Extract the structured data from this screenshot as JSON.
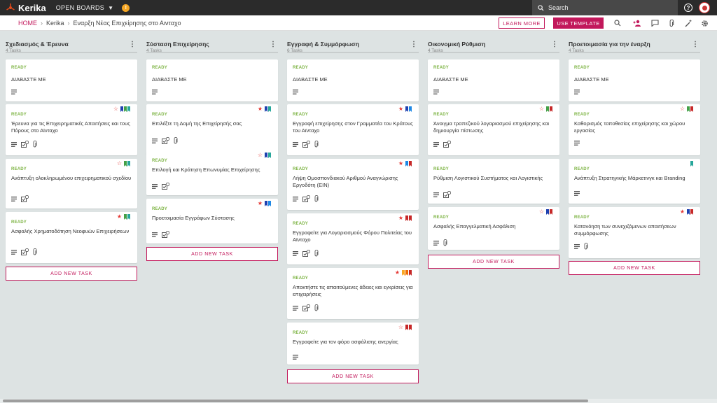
{
  "topbar": {
    "logo_text": "Kerika",
    "open_boards": "OPEN BOARDS",
    "notification_badge": "!",
    "search_label": "Search",
    "help_label": "?"
  },
  "breadcrumb": {
    "home": "HOME",
    "account": "Kerika",
    "board": "Εναρξη Νέας Επιχείρησης στο Αινταχο"
  },
  "toolbar": {
    "learn_more": "LEARN MORE",
    "use_template": "USE TEMPLATE"
  },
  "colors": {
    "accent": "#c2185b",
    "ready": "#7cb342",
    "star": "#e53935"
  },
  "add_task_label": "ADD NEW TASK",
  "columns": [
    {
      "title": "Σχεδιασμός & Έρευνα",
      "count": "4 Tasks",
      "cards": [
        {
          "status": "READY",
          "title": "ΔΙΑΒΑΣΤΕ ΜΕ",
          "star": "none",
          "flags": [],
          "icons": [
            "description"
          ]
        },
        {
          "status": "READY",
          "title": "Έρευνα για τις Επιχειρηματικές Απαιτήσεις και τους Πόρους στο Αϊνταχο",
          "star": "outline",
          "flags": [
            "#1e40af",
            "#43a047",
            "#26a69a"
          ],
          "icons": [
            "description",
            "checklist",
            "attachment"
          ]
        },
        {
          "status": "READY",
          "title": "Ανάπτυξη ολοκληρωμένου επιχειρηματικού σχεδίου",
          "star": "outline",
          "flags": [
            "#43a047",
            "#26a69a"
          ],
          "icons": [
            "description",
            "checklist"
          ]
        },
        {
          "status": "READY",
          "title": "Ασφαλής Χρηματοδότηση Νεοφυών Επιχειρήσεων",
          "star": "filled",
          "flags": [
            "#43a047",
            "#26a69a"
          ],
          "icons": [
            "description",
            "checklist",
            "attachment"
          ]
        }
      ]
    },
    {
      "title": "Σύσταση Επιχείρησης",
      "count": "4 Tasks",
      "cards": [
        {
          "status": "READY",
          "title": "ΔΙΑΒΑΣΤΕ ΜΕ",
          "star": "none",
          "flags": [],
          "icons": [
            "description"
          ]
        },
        {
          "status": "READY",
          "title": "Επιλέξτε τη Δομή της Επιχείρησής σας",
          "star": "filled",
          "flags": [
            "#1e40af",
            "#26a69a"
          ],
          "icons": [
            "description",
            "checklist",
            "attachment"
          ]
        },
        {
          "status": "READY",
          "title": "Επιλογή και Κράτηση Επωνυμίας Επιχείρησης",
          "star": "outline",
          "flags": [
            "#1e40af",
            "#26a69a"
          ],
          "icons": [
            "description",
            "checklist"
          ]
        },
        {
          "status": "READY",
          "title": "Προετοιμασία Εγγράφων Σύστασης",
          "star": "filled",
          "flags": [
            "#1e40af",
            "#1e88e5"
          ],
          "icons": [
            "description",
            "checklist"
          ]
        }
      ]
    },
    {
      "title": "Εγγραφή & Συμμόρφωση",
      "count": "6 Tasks",
      "cards": [
        {
          "status": "READY",
          "title": "ΔΙΑΒΑΣΤΕ ΜΕ",
          "star": "none",
          "flags": [],
          "icons": [
            "description"
          ]
        },
        {
          "status": "READY",
          "title": "Εγγραφή επιχείρησης στον Γραμματέα του Κράτους του Αϊνταχο",
          "star": "filled",
          "flags": [
            "#1e40af",
            "#1e88e5"
          ],
          "icons": [
            "description",
            "checklist",
            "attachment"
          ]
        },
        {
          "status": "READY",
          "title": "Λήψη Ομοσπονδιακού Αριθμού Αναγνώρισης Εργοδότη (EIN)",
          "star": "filled",
          "flags": [
            "#1e88e5",
            "#c62828"
          ],
          "icons": [
            "description",
            "checklist",
            "attachment"
          ]
        },
        {
          "status": "READY",
          "title": "Εγγραφείτε για Λογαριασμούς Φόρου Πολιτείας του Αϊνταχο",
          "star": "filled",
          "flags": [
            "#c62828",
            "#c62828"
          ],
          "icons": [
            "description",
            "checklist",
            "attachment"
          ]
        },
        {
          "status": "READY",
          "title": "Αποκτήστε τις απαιτούμενες άδειες και εγκρίσεις για επιχειρήσεις",
          "star": "filled",
          "flags": [
            "#f9a825",
            "#ef6c00",
            "#c62828"
          ],
          "icons": [
            "description",
            "checklist",
            "attachment"
          ]
        },
        {
          "status": "READY",
          "title": "Εγγραφείτε για τον φόρο ασφάλισης ανεργίας",
          "star": "outline",
          "flags": [
            "#c62828",
            "#c62828"
          ],
          "icons": [
            "description"
          ]
        }
      ]
    },
    {
      "title": "Οικονομική Ρύθμιση",
      "count": "4 Tasks",
      "cards": [
        {
          "status": "READY",
          "title": "ΔΙΑΒΑΣΤΕ ΜΕ",
          "star": "none",
          "flags": [],
          "icons": [
            "description"
          ]
        },
        {
          "status": "READY",
          "title": "Άνοιγμα τραπεζικού λογαριασμού επιχείρησης και δημιουργία πίστωσης",
          "star": "outline",
          "flags": [
            "#43a047",
            "#c62828"
          ],
          "icons": [
            "description",
            "checklist"
          ]
        },
        {
          "status": "READY",
          "title": "Ρύθμιση Λογιστικού Συστήματος και Λογιστικής",
          "star": "none",
          "flags": [],
          "icons": [
            "description",
            "checklist"
          ]
        },
        {
          "status": "READY",
          "title": "Ασφαλής Επαγγελματική Ασφάλιση",
          "star": "outline",
          "flags": [
            "#1e40af",
            "#c62828"
          ],
          "icons": [
            "description",
            "attachment"
          ]
        }
      ]
    },
    {
      "title": "Προετοιμασία για την έναρξη",
      "count": "4 Tasks",
      "cards": [
        {
          "status": "READY",
          "title": "ΔΙΑΒΑΣΤΕ ΜΕ",
          "star": "none",
          "flags": [],
          "icons": [
            "description"
          ]
        },
        {
          "status": "READY",
          "title": "Καθορισμός τοποθεσίας επιχείρησης και χώρου εργασίας",
          "star": "outline",
          "flags": [
            "#43a047",
            "#c62828"
          ],
          "icons": [
            "description"
          ]
        },
        {
          "status": "READY",
          "title": "Ανάπτυξη Στρατηγικής Μάρκετινγκ και Branding",
          "star": "none",
          "flags": [
            "#26a69a"
          ],
          "icons": [
            "description"
          ]
        },
        {
          "status": "READY",
          "title": "Κατανόηση των συνεχιζόμενων απαιτήσεων συμμόρφωσης",
          "star": "filled",
          "flags": [
            "#1e40af",
            "#c62828"
          ],
          "icons": [
            "description",
            "attachment"
          ]
        }
      ]
    }
  ]
}
